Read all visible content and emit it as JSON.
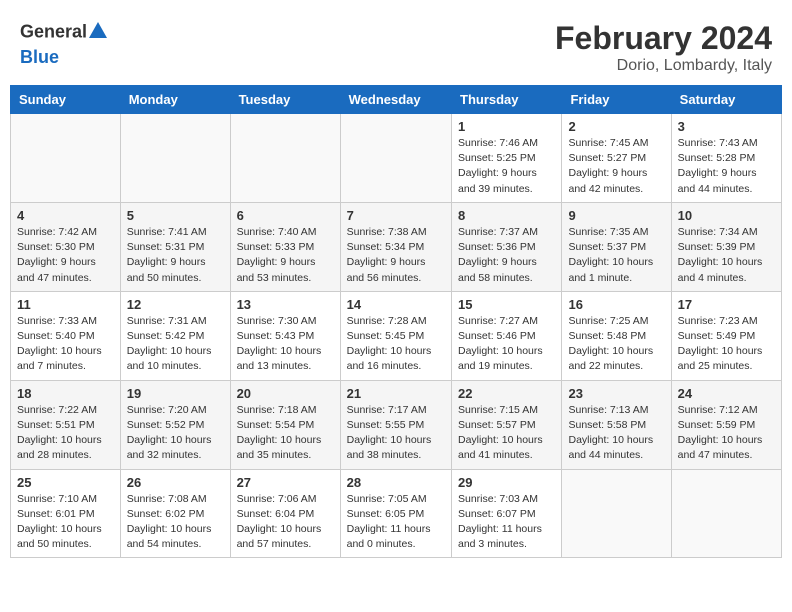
{
  "header": {
    "logo_general": "General",
    "logo_blue": "Blue",
    "month_year": "February 2024",
    "location": "Dorio, Lombardy, Italy"
  },
  "days_of_week": [
    "Sunday",
    "Monday",
    "Tuesday",
    "Wednesday",
    "Thursday",
    "Friday",
    "Saturday"
  ],
  "weeks": [
    [
      {
        "day": "",
        "info": ""
      },
      {
        "day": "",
        "info": ""
      },
      {
        "day": "",
        "info": ""
      },
      {
        "day": "",
        "info": ""
      },
      {
        "day": "1",
        "info": "Sunrise: 7:46 AM\nSunset: 5:25 PM\nDaylight: 9 hours\nand 39 minutes."
      },
      {
        "day": "2",
        "info": "Sunrise: 7:45 AM\nSunset: 5:27 PM\nDaylight: 9 hours\nand 42 minutes."
      },
      {
        "day": "3",
        "info": "Sunrise: 7:43 AM\nSunset: 5:28 PM\nDaylight: 9 hours\nand 44 minutes."
      }
    ],
    [
      {
        "day": "4",
        "info": "Sunrise: 7:42 AM\nSunset: 5:30 PM\nDaylight: 9 hours\nand 47 minutes."
      },
      {
        "day": "5",
        "info": "Sunrise: 7:41 AM\nSunset: 5:31 PM\nDaylight: 9 hours\nand 50 minutes."
      },
      {
        "day": "6",
        "info": "Sunrise: 7:40 AM\nSunset: 5:33 PM\nDaylight: 9 hours\nand 53 minutes."
      },
      {
        "day": "7",
        "info": "Sunrise: 7:38 AM\nSunset: 5:34 PM\nDaylight: 9 hours\nand 56 minutes."
      },
      {
        "day": "8",
        "info": "Sunrise: 7:37 AM\nSunset: 5:36 PM\nDaylight: 9 hours\nand 58 minutes."
      },
      {
        "day": "9",
        "info": "Sunrise: 7:35 AM\nSunset: 5:37 PM\nDaylight: 10 hours\nand 1 minute."
      },
      {
        "day": "10",
        "info": "Sunrise: 7:34 AM\nSunset: 5:39 PM\nDaylight: 10 hours\nand 4 minutes."
      }
    ],
    [
      {
        "day": "11",
        "info": "Sunrise: 7:33 AM\nSunset: 5:40 PM\nDaylight: 10 hours\nand 7 minutes."
      },
      {
        "day": "12",
        "info": "Sunrise: 7:31 AM\nSunset: 5:42 PM\nDaylight: 10 hours\nand 10 minutes."
      },
      {
        "day": "13",
        "info": "Sunrise: 7:30 AM\nSunset: 5:43 PM\nDaylight: 10 hours\nand 13 minutes."
      },
      {
        "day": "14",
        "info": "Sunrise: 7:28 AM\nSunset: 5:45 PM\nDaylight: 10 hours\nand 16 minutes."
      },
      {
        "day": "15",
        "info": "Sunrise: 7:27 AM\nSunset: 5:46 PM\nDaylight: 10 hours\nand 19 minutes."
      },
      {
        "day": "16",
        "info": "Sunrise: 7:25 AM\nSunset: 5:48 PM\nDaylight: 10 hours\nand 22 minutes."
      },
      {
        "day": "17",
        "info": "Sunrise: 7:23 AM\nSunset: 5:49 PM\nDaylight: 10 hours\nand 25 minutes."
      }
    ],
    [
      {
        "day": "18",
        "info": "Sunrise: 7:22 AM\nSunset: 5:51 PM\nDaylight: 10 hours\nand 28 minutes."
      },
      {
        "day": "19",
        "info": "Sunrise: 7:20 AM\nSunset: 5:52 PM\nDaylight: 10 hours\nand 32 minutes."
      },
      {
        "day": "20",
        "info": "Sunrise: 7:18 AM\nSunset: 5:54 PM\nDaylight: 10 hours\nand 35 minutes."
      },
      {
        "day": "21",
        "info": "Sunrise: 7:17 AM\nSunset: 5:55 PM\nDaylight: 10 hours\nand 38 minutes."
      },
      {
        "day": "22",
        "info": "Sunrise: 7:15 AM\nSunset: 5:57 PM\nDaylight: 10 hours\nand 41 minutes."
      },
      {
        "day": "23",
        "info": "Sunrise: 7:13 AM\nSunset: 5:58 PM\nDaylight: 10 hours\nand 44 minutes."
      },
      {
        "day": "24",
        "info": "Sunrise: 7:12 AM\nSunset: 5:59 PM\nDaylight: 10 hours\nand 47 minutes."
      }
    ],
    [
      {
        "day": "25",
        "info": "Sunrise: 7:10 AM\nSunset: 6:01 PM\nDaylight: 10 hours\nand 50 minutes."
      },
      {
        "day": "26",
        "info": "Sunrise: 7:08 AM\nSunset: 6:02 PM\nDaylight: 10 hours\nand 54 minutes."
      },
      {
        "day": "27",
        "info": "Sunrise: 7:06 AM\nSunset: 6:04 PM\nDaylight: 10 hours\nand 57 minutes."
      },
      {
        "day": "28",
        "info": "Sunrise: 7:05 AM\nSunset: 6:05 PM\nDaylight: 11 hours\nand 0 minutes."
      },
      {
        "day": "29",
        "info": "Sunrise: 7:03 AM\nSunset: 6:07 PM\nDaylight: 11 hours\nand 3 minutes."
      },
      {
        "day": "",
        "info": ""
      },
      {
        "day": "",
        "info": ""
      }
    ]
  ]
}
